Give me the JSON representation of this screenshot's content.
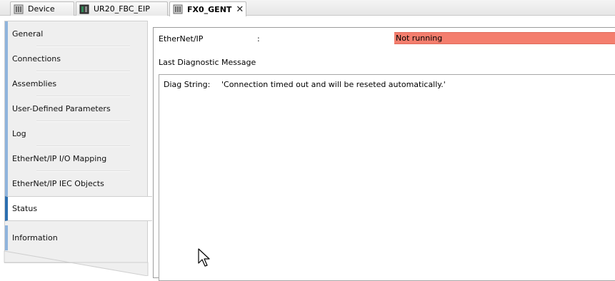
{
  "tabs": [
    {
      "label": "Device",
      "icon": "device-module-icon",
      "active": false
    },
    {
      "label": "UR20_FBC_EIP",
      "icon": "fieldbus-coupler-icon",
      "active": false
    },
    {
      "label": "FX0_GENT",
      "icon": "device-module-icon",
      "active": true,
      "close_glyph": "✕"
    }
  ],
  "sidebar": {
    "items": [
      {
        "label": "General"
      },
      {
        "label": "Connections"
      },
      {
        "label": "Assemblies"
      },
      {
        "label": "User-Defined Parameters"
      },
      {
        "label": "Log"
      },
      {
        "label": "EtherNet/IP I/O Mapping"
      },
      {
        "label": "EtherNet/IP IEC Objects"
      },
      {
        "label": "Status",
        "selected": true
      },
      {
        "label": "Information"
      }
    ]
  },
  "status": {
    "protocol_label": "EtherNet/IP",
    "colon": ":",
    "state": "Not running",
    "state_color": "#f47e6e"
  },
  "diagnostics": {
    "title": "Last Diagnostic Message",
    "label": "Diag String:",
    "value": "'Connection timed out and will be reseted automatically.'"
  },
  "colors": {
    "accent_selected": "#2c6fb0",
    "accent_item": "#8fb4dc",
    "nav_background": "#efefef"
  }
}
